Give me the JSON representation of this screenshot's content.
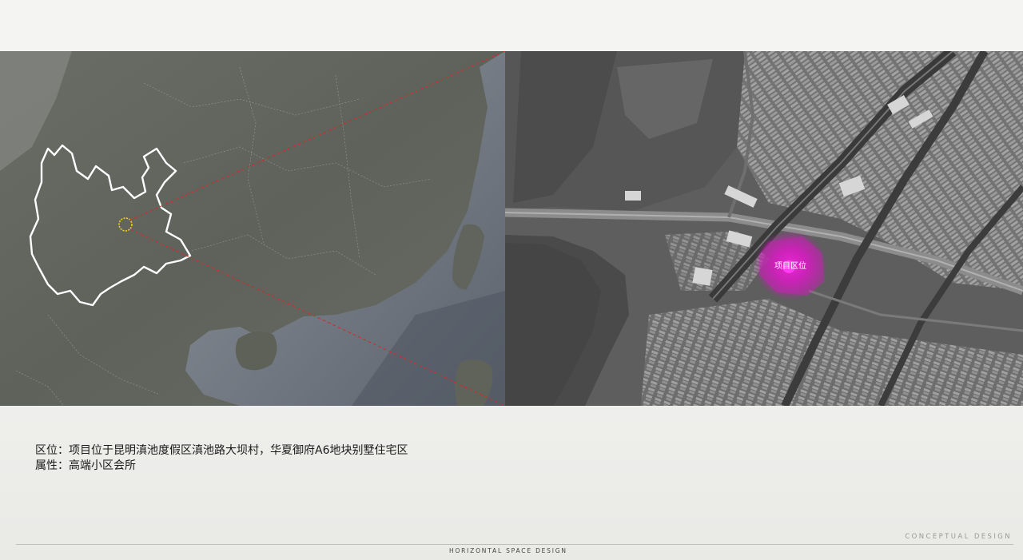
{
  "caption": {
    "line1": "区位：项目位于昆明滇池度假区滇池路大坝村，华夏御府A6地块别墅住宅区",
    "line2": "属性：高端小区会所"
  },
  "map": {
    "site_label": "项目区位",
    "highlight_color": "#e018c8",
    "connector_color": "#d42a2a",
    "province_outline_color": "#ffffff",
    "locator_color": "#f2d21a"
  },
  "footer": {
    "right": "CONCEPTUAL DESIGN",
    "center": "HORIZONTAL SPACE DESIGN"
  }
}
